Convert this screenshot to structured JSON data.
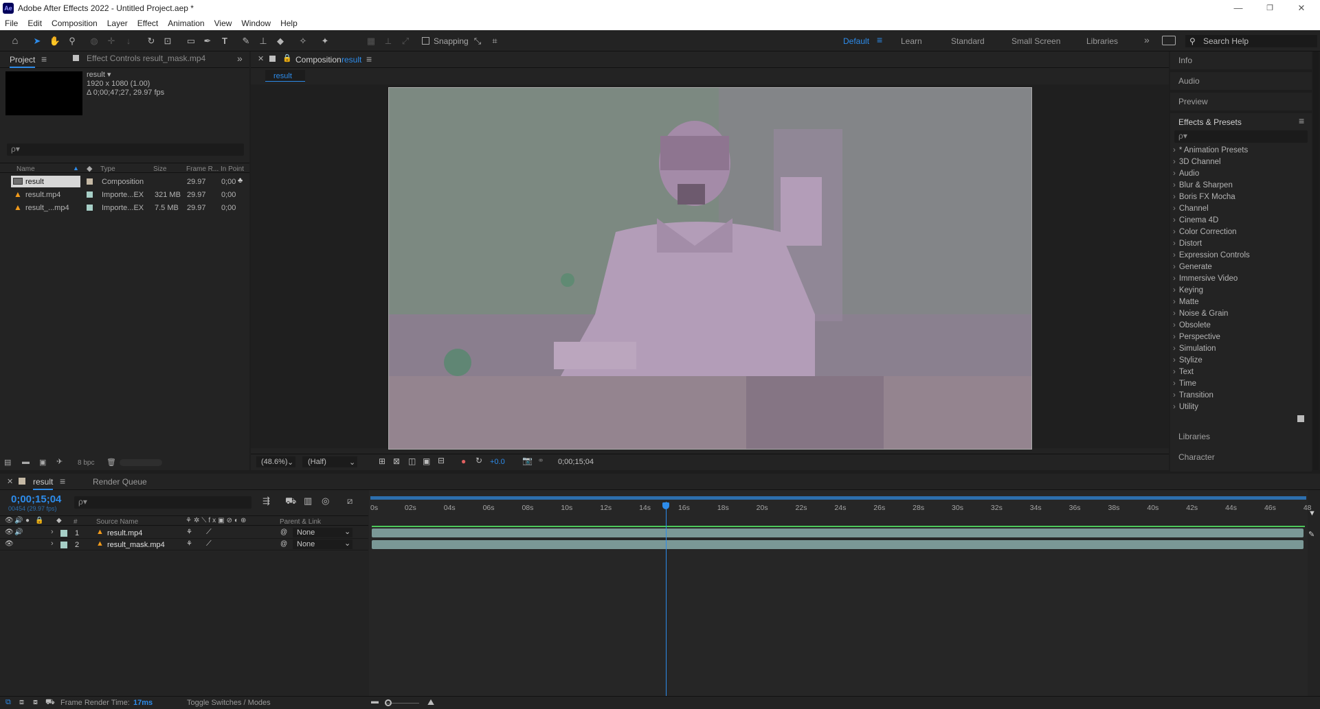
{
  "window": {
    "title": "Adobe After Effects 2022 - Untitled Project.aep *",
    "logo_text": "Ae",
    "minimize": "—",
    "maximize": "❐",
    "close": "✕"
  },
  "menu": [
    "File",
    "Edit",
    "Composition",
    "Layer",
    "Effect",
    "Animation",
    "View",
    "Window",
    "Help"
  ],
  "toolbar": {
    "snapping_label": "Snapping",
    "workspaces": [
      "Default",
      "Learn",
      "Standard",
      "Small Screen",
      "Libraries"
    ],
    "active_workspace": "Default",
    "search_help_placeholder": "Search Help",
    "overflow": "»"
  },
  "project_panel": {
    "tab_project": "Project",
    "tab_effect_controls": "Effect Controls result_mask.mp4",
    "selected_name": "result ▾",
    "selected_dims": "1920 x 1080 (1.00)",
    "selected_duration": "Δ 0;00;47;27, 29.97 fps",
    "search_placeholder": "ρ▾",
    "columns": [
      "Name",
      "Type",
      "Size",
      "Frame R...",
      "In Point"
    ],
    "items": [
      {
        "name": "result",
        "type": "Composition",
        "size": "",
        "frame_rate": "29.97",
        "in_point": "0;00",
        "color": "#c5b9a5"
      },
      {
        "name": "result.mp4",
        "type": "Importe...EX",
        "size": "321 MB",
        "frame_rate": "29.97",
        "in_point": "0;00",
        "color": "#a7cfc7"
      },
      {
        "name": "result_...mp4",
        "type": "Importe...EX",
        "size": "7.5 MB",
        "frame_rate": "29.97",
        "in_point": "0;00",
        "color": "#a7cfc7"
      }
    ],
    "bpc_label": "8 bpc"
  },
  "composition_panel": {
    "tab_label": "Composition",
    "tab_comp_name": "result",
    "breadcrumb": "result",
    "zoom": "(48.6%)",
    "resolution": "(Half)",
    "exposure": "+0.0",
    "timecode": "0;00;15;04"
  },
  "right_panels": {
    "info": "Info",
    "audio": "Audio",
    "preview": "Preview",
    "effects_presets": "Effects & Presets",
    "effects_search_placeholder": "ρ▾",
    "effect_categories": [
      "* Animation Presets",
      "3D Channel",
      "Audio",
      "Blur & Sharpen",
      "Boris FX Mocha",
      "Channel",
      "Cinema 4D",
      "Color Correction",
      "Distort",
      "Expression Controls",
      "Generate",
      "Immersive Video",
      "Keying",
      "Matte",
      "Noise & Grain",
      "Obsolete",
      "Perspective",
      "Simulation",
      "Stylize",
      "Text",
      "Time",
      "Transition",
      "Utility"
    ],
    "libraries": "Libraries",
    "character": "Character"
  },
  "timeline": {
    "tab_comp": "result",
    "tab_render_queue": "Render Queue",
    "current_time": "0;00;15;04",
    "current_frame": "00454 (29.97 fps)",
    "search_placeholder": "ρ▾",
    "col_hash": "#",
    "col_source_name": "Source Name",
    "col_parent_link": "Parent & Link",
    "layers": [
      {
        "index": "1",
        "name": "result.mp4",
        "parent": "None"
      },
      {
        "index": "2",
        "name": "result_mask.mp4",
        "parent": "None"
      }
    ],
    "ruler_labels": [
      "0s",
      "02s",
      "04s",
      "06s",
      "08s",
      "10s",
      "12s",
      "14s",
      "16s",
      "18s",
      "20s",
      "22s",
      "24s",
      "26s",
      "28s",
      "30s",
      "32s",
      "34s",
      "36s",
      "38s",
      "40s",
      "42s",
      "44s",
      "46s",
      "48"
    ],
    "playhead_seconds": 15.13,
    "duration_seconds": 47.9,
    "frame_render_label": "Frame Render Time:",
    "frame_render_value": "17ms",
    "toggle_label": "Toggle Switches / Modes"
  },
  "colors": {
    "accent": "#2d8ceb",
    "panel_bg": "#232323",
    "layer_bar": "#7a9896"
  }
}
